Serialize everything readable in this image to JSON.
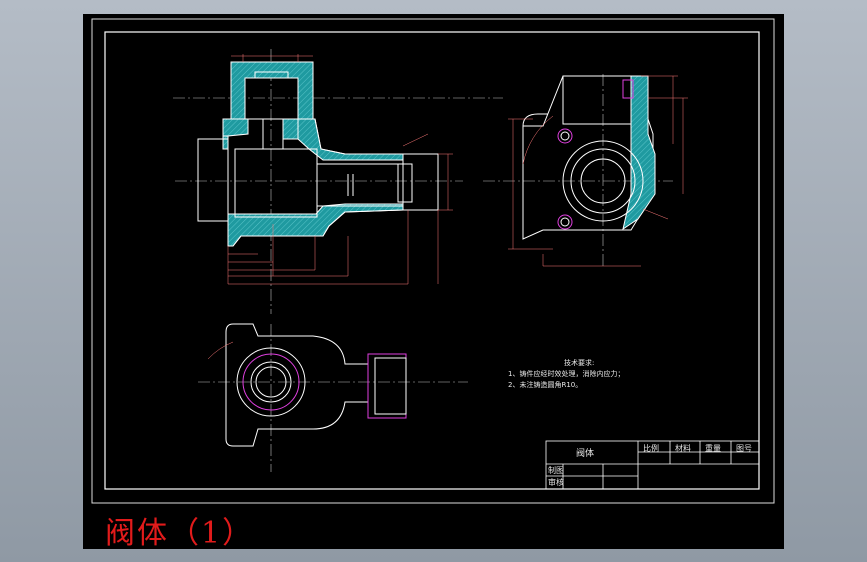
{
  "caption": "阀体（1）",
  "technical_notes": {
    "title": "技术要求:",
    "items": [
      "1、铸件应经时效处理，消除内应力；",
      "2、未注铸造圆角R10。"
    ]
  },
  "title_block": {
    "part_name": "阀体",
    "headers": [
      "比例",
      "材料",
      "重量",
      "图号"
    ],
    "rows": [
      "制图",
      "审核"
    ]
  },
  "colors": {
    "background": "#000000",
    "outline": "#ffffff",
    "dimension": "#ff6a6a",
    "section_fill": "#1f9aa0",
    "hole": "#e040e0",
    "caption": "#e11b1b"
  }
}
